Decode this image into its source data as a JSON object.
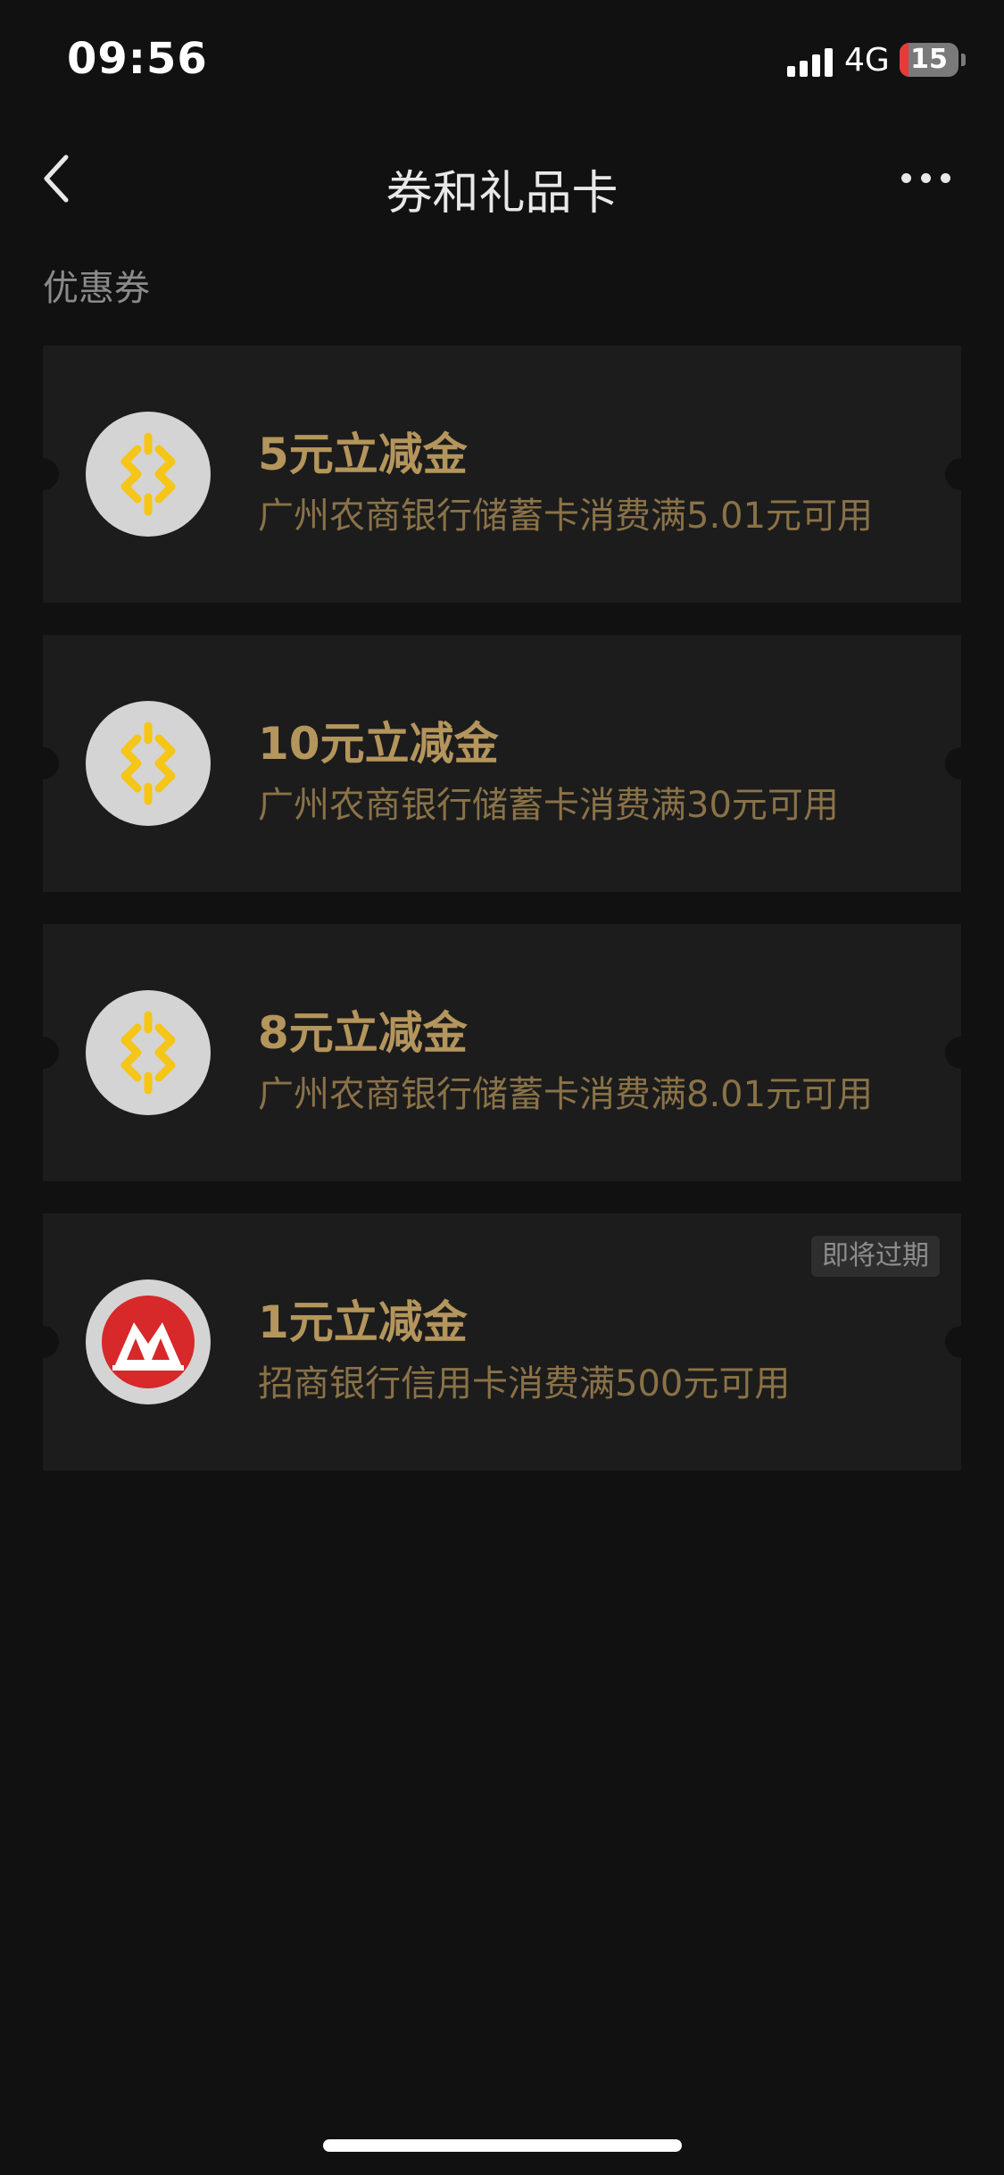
{
  "status_bar": {
    "time": "09:56",
    "network": "4G",
    "battery_level": "15",
    "battery_fraction": 0.15,
    "battery_color": "#e83a3a"
  },
  "nav": {
    "title": "券和礼品卡",
    "back_icon": "chevron-left-icon",
    "more_icon": "more-horizontal-icon"
  },
  "section": {
    "title": "优惠券"
  },
  "coupons": [
    {
      "title": "5元立减金",
      "description": "广州农商银行储蓄卡消费满5.01元可用",
      "bank_icon": "grcb-logo-icon",
      "badge": ""
    },
    {
      "title": "10元立减金",
      "description": "广州农商银行储蓄卡消费满30元可用",
      "bank_icon": "grcb-logo-icon",
      "badge": ""
    },
    {
      "title": "8元立减金",
      "description": "广州农商银行储蓄卡消费满8.01元可用",
      "bank_icon": "grcb-logo-icon",
      "badge": ""
    },
    {
      "title": "1元立减金",
      "description": "招商银行信用卡消费满500元可用",
      "bank_icon": "cmb-logo-icon",
      "badge": "即将过期"
    }
  ],
  "colors": {
    "background": "#111111",
    "card": "#1c1c1c",
    "coupon_title": "#b4955c",
    "coupon_desc": "#8a7248",
    "grcb_yellow": "#f5c518",
    "cmb_red": "#d7282a"
  }
}
